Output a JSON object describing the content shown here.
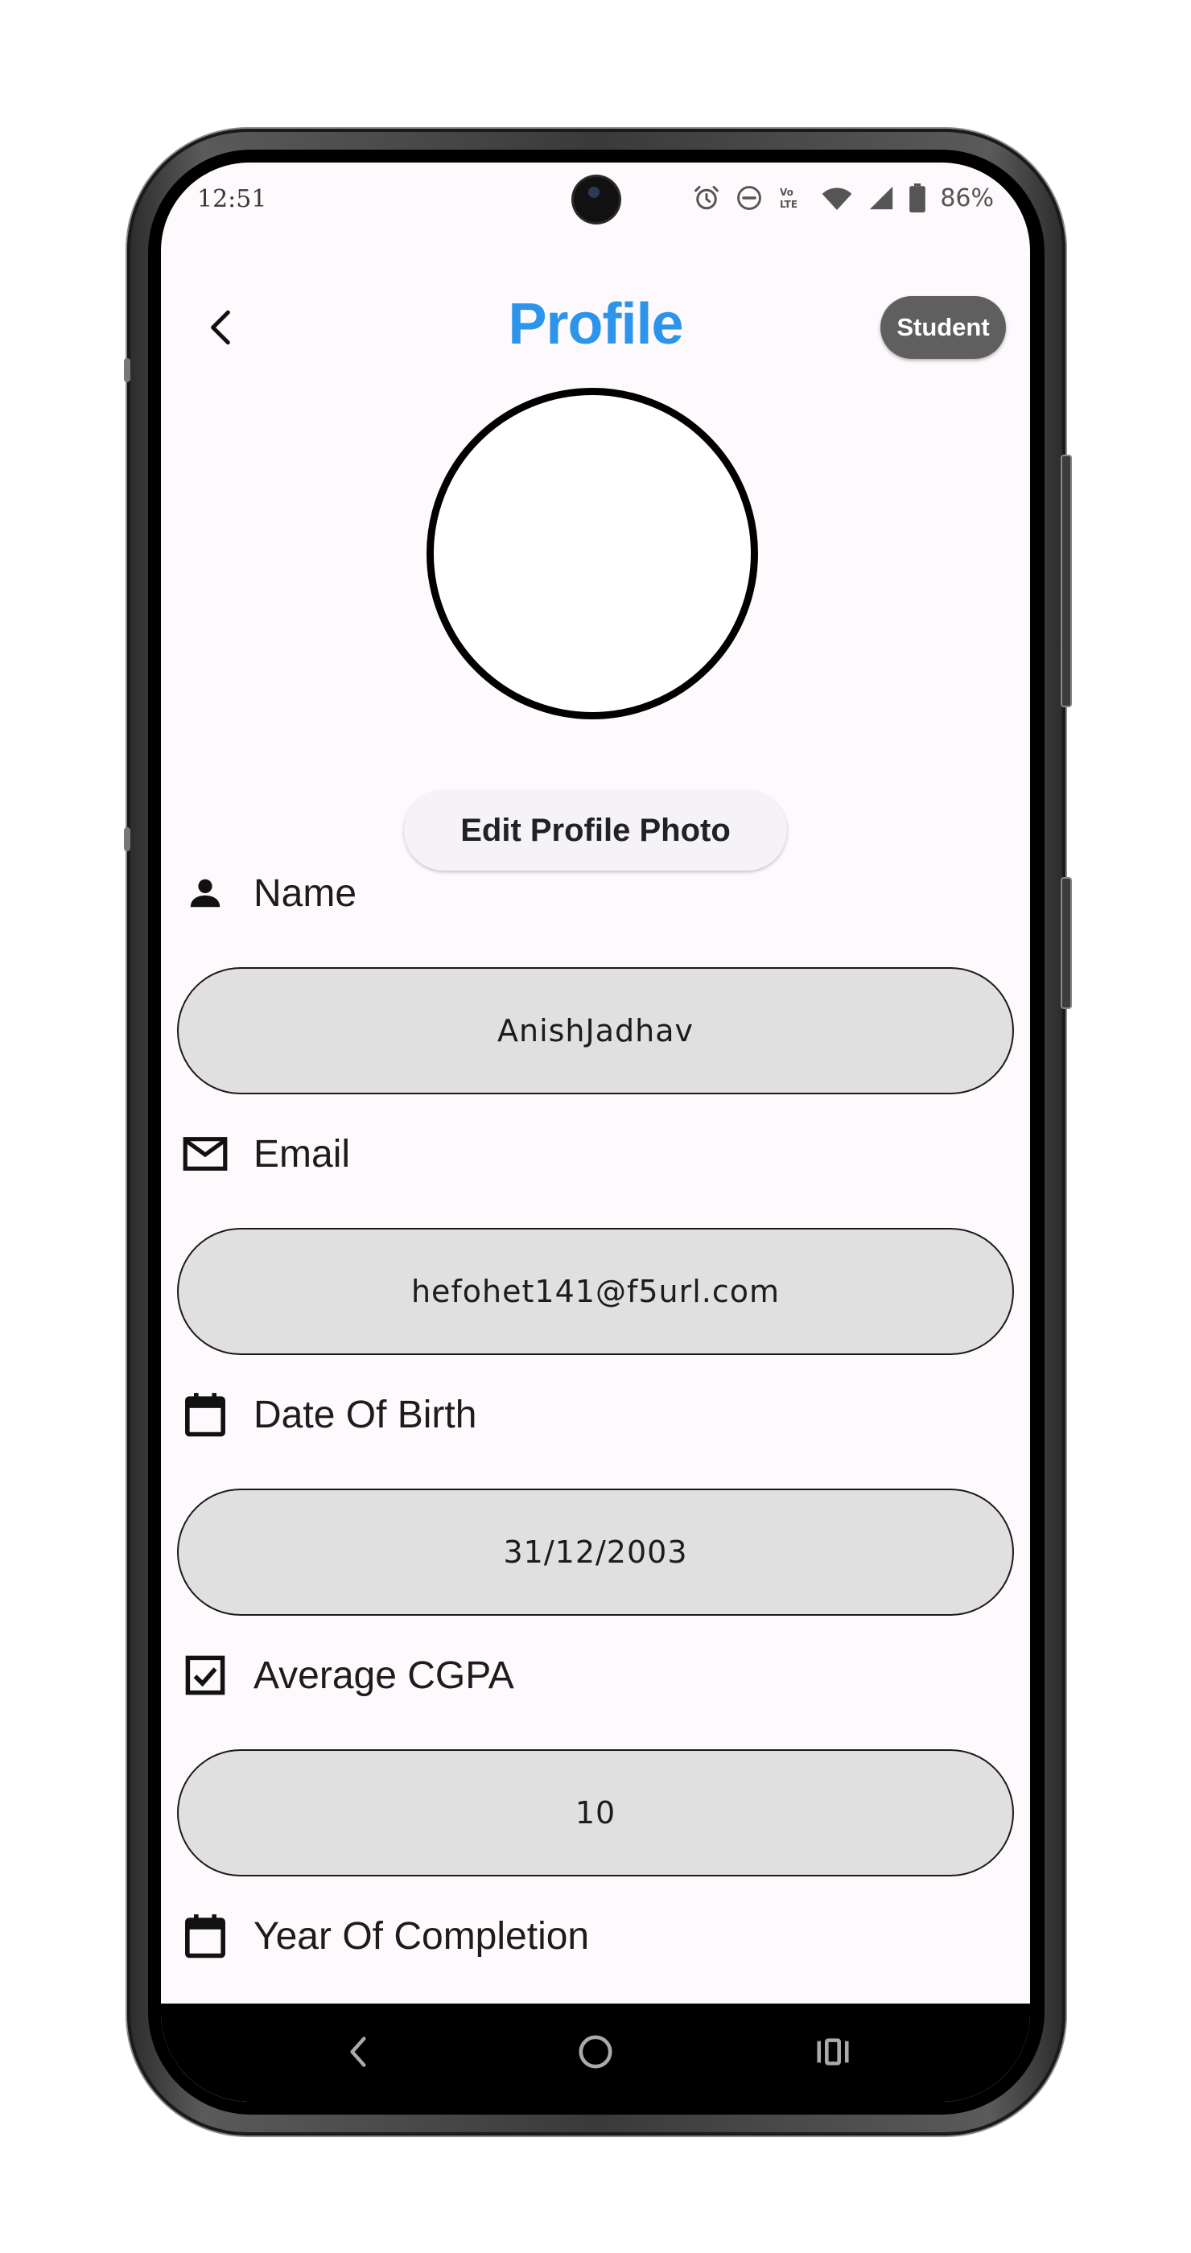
{
  "status_bar": {
    "time": "12:51",
    "battery": "86%",
    "icons": [
      "alarm-icon",
      "do-not-disturb-icon",
      "volte-icon",
      "wifi-icon",
      "signal-icon",
      "battery-icon"
    ]
  },
  "header": {
    "title": "Profile",
    "role_badge": "Student",
    "title_color": "#2C94EA"
  },
  "avatar": {
    "edit_button_label": "Edit Profile Photo"
  },
  "fields": [
    {
      "icon": "person-icon",
      "label": "Name",
      "value": "AnishJadhav"
    },
    {
      "icon": "mail-icon",
      "label": "Email",
      "value": "hefohet141@f5url.com"
    },
    {
      "icon": "calendar-icon",
      "label": "Date Of Birth",
      "value": "31/12/2003"
    },
    {
      "icon": "checkbox-icon",
      "label": "Average CGPA",
      "value": "10"
    },
    {
      "icon": "calendar-icon",
      "label": "Year Of Completion",
      "value": ""
    }
  ],
  "nav_bar": {
    "icons": [
      "back-nav-icon",
      "home-nav-icon",
      "recents-nav-icon"
    ]
  }
}
